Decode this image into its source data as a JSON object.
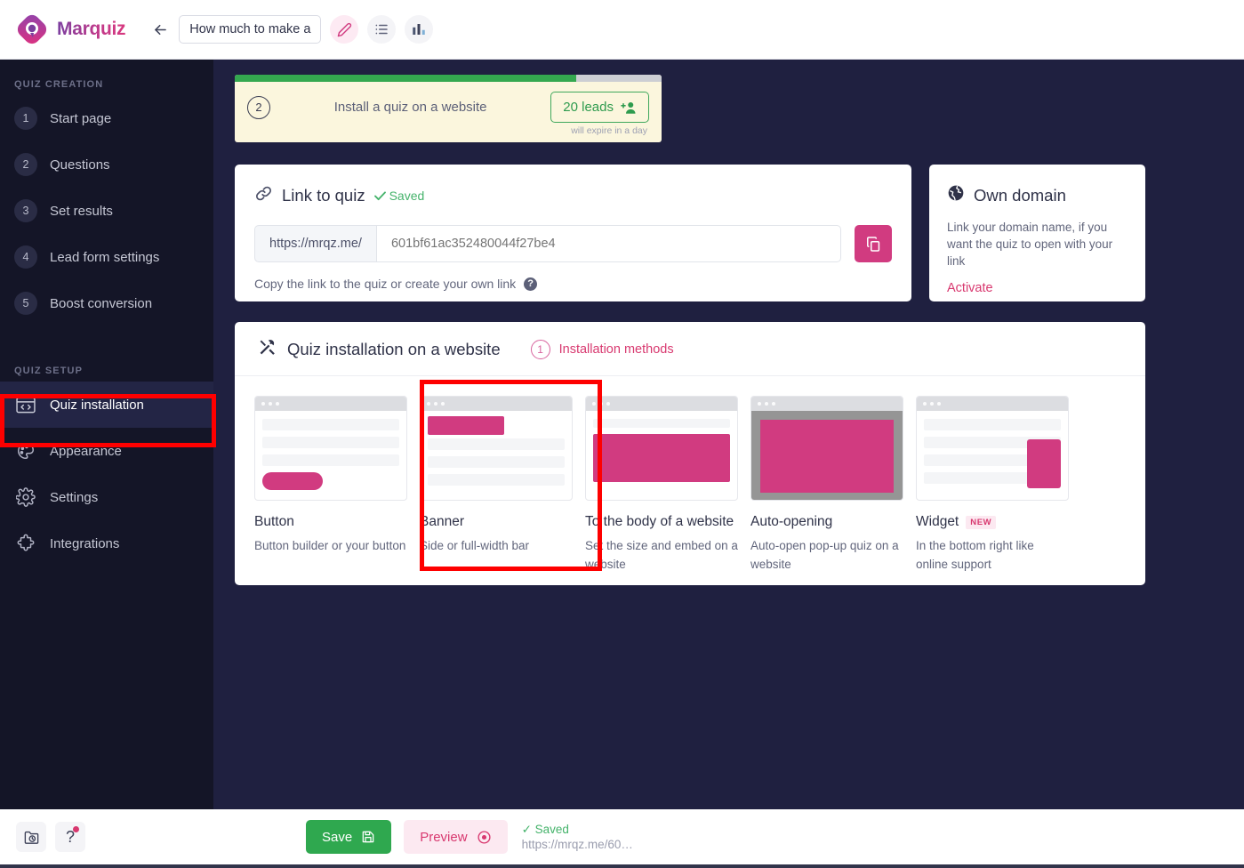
{
  "brand": {
    "name": "Marquiz",
    "logo_icon": "marquiz-logo-icon"
  },
  "topbar": {
    "back_icon": "arrow-left-icon",
    "quiz_title": "How much to make a",
    "tools": [
      {
        "icon": "pencil-icon",
        "name": "edit-quiz-button"
      },
      {
        "icon": "list-icon",
        "name": "quiz-list-button"
      },
      {
        "icon": "bar-chart-icon",
        "name": "statistics-button"
      }
    ]
  },
  "sidebar": {
    "group_creation_label": "QUIZ CREATION",
    "creation_items": [
      {
        "num": "1",
        "label": "Start page"
      },
      {
        "num": "2",
        "label": "Questions"
      },
      {
        "num": "3",
        "label": "Set results"
      },
      {
        "num": "4",
        "label": "Lead form settings"
      },
      {
        "num": "5",
        "label": "Boost conversion"
      }
    ],
    "group_setup_label": "QUIZ SETUP",
    "setup_items": [
      {
        "icon": "code-window-icon",
        "label": "Quiz installation",
        "active": true
      },
      {
        "icon": "palette-icon",
        "label": "Appearance",
        "active": false
      },
      {
        "icon": "gear-icon",
        "label": "Settings",
        "active": false
      },
      {
        "icon": "puzzle-icon",
        "label": "Integrations",
        "active": false
      }
    ]
  },
  "notification": {
    "progress_percent": 80,
    "step_number": "2",
    "text": "Install a quiz on a website",
    "leads_label": "20 leads",
    "leads_icon": "add-user-icon",
    "expire_text": "will expire in a day"
  },
  "link_card": {
    "icon": "link-icon",
    "title": "Link to quiz",
    "saved_label": "Saved",
    "url_prefix": "https://mrqz.me/",
    "url_value": "601bf61ac352480044f27be4",
    "copy_icon": "copy-icon",
    "hint": "Copy the link to the quiz or create your own link",
    "help_icon": "question-mark-icon"
  },
  "domain_card": {
    "icon": "globe-icon",
    "title": "Own domain",
    "description": "Link your domain name, if you want the quiz to open with your link",
    "activate_label": "Activate"
  },
  "install_card": {
    "icon": "tools-icon",
    "title": "Quiz installation on a website",
    "methods_number": "1",
    "methods_label": "Installation methods",
    "methods": [
      {
        "id": "button",
        "title": "Button",
        "desc": "Button builder or your button",
        "badge": ""
      },
      {
        "id": "banner",
        "title": "Banner",
        "desc": "Side or full-width bar",
        "badge": ""
      },
      {
        "id": "body",
        "title": "To the body of a website",
        "desc": "Set the size and embed on a website",
        "badge": ""
      },
      {
        "id": "auto",
        "title": "Auto-opening",
        "desc": "Auto-open pop-up quiz on a website",
        "badge": ""
      },
      {
        "id": "widget",
        "title": "Widget",
        "desc": "In the bottom right like online support",
        "badge": "NEW"
      }
    ]
  },
  "bottombar": {
    "history_icon": "folder-clock-icon",
    "help_icon": "question-mark-icon",
    "save_label": "Save",
    "save_icon": "floppy-disk-icon",
    "preview_label": "Preview",
    "preview_icon": "eye-icon",
    "status_saved": "✓ Saved",
    "status_url": "https://mrqz.me/60…"
  },
  "colors": {
    "accent_pink": "#d13b80",
    "accent_link": "#d8386f",
    "green": "#2fa84f",
    "sidebar_bg": "#141527",
    "main_bg": "#1f2040",
    "annotation_red": "#fe0000"
  }
}
